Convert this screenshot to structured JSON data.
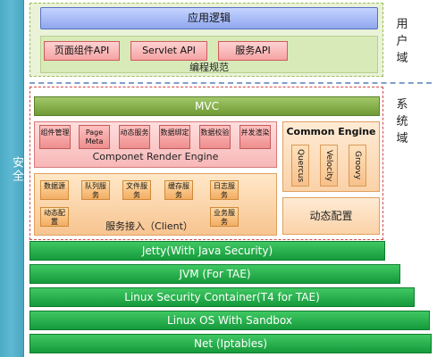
{
  "sidebar": {
    "label": "安全",
    "color": "#4bacc6"
  },
  "user_domain": {
    "label": "用户域",
    "app_logic": "应用逻辑",
    "apis": [
      "页面组件API",
      "Servlet API",
      "服务API"
    ],
    "coding_spec": "编程规范"
  },
  "system_domain": {
    "label": "系统域",
    "mvc": "MVC",
    "component_engine": {
      "items": [
        "组件管理",
        "Page Meta",
        "动态服务",
        "数据绑定",
        "数据校验",
        "并发渲染"
      ],
      "label": "Componet Render Engine"
    },
    "common_engine": {
      "title": "Common Engine",
      "items": [
        "Quercus",
        "Velocity",
        "Groovy"
      ]
    },
    "service_access": {
      "items": [
        "数据源",
        "队列服务",
        "文件服务",
        "缓存服务",
        "日志服务",
        "动态配置",
        "业务服务"
      ],
      "label": "服务接入（Client）"
    },
    "dynamic_config": "动态配置"
  },
  "infrastructure": [
    "Jetty(With Java Security)",
    "JVM (For TAE)",
    "Linux Security Container(T4 for TAE)",
    "Linux OS With Sandbox",
    "Net (Iptables)"
  ],
  "colors": {
    "mvc": "#8ab24e",
    "infra": "#20a847",
    "api": "#f4a3a3",
    "app_logic": "#8fa6ee"
  }
}
